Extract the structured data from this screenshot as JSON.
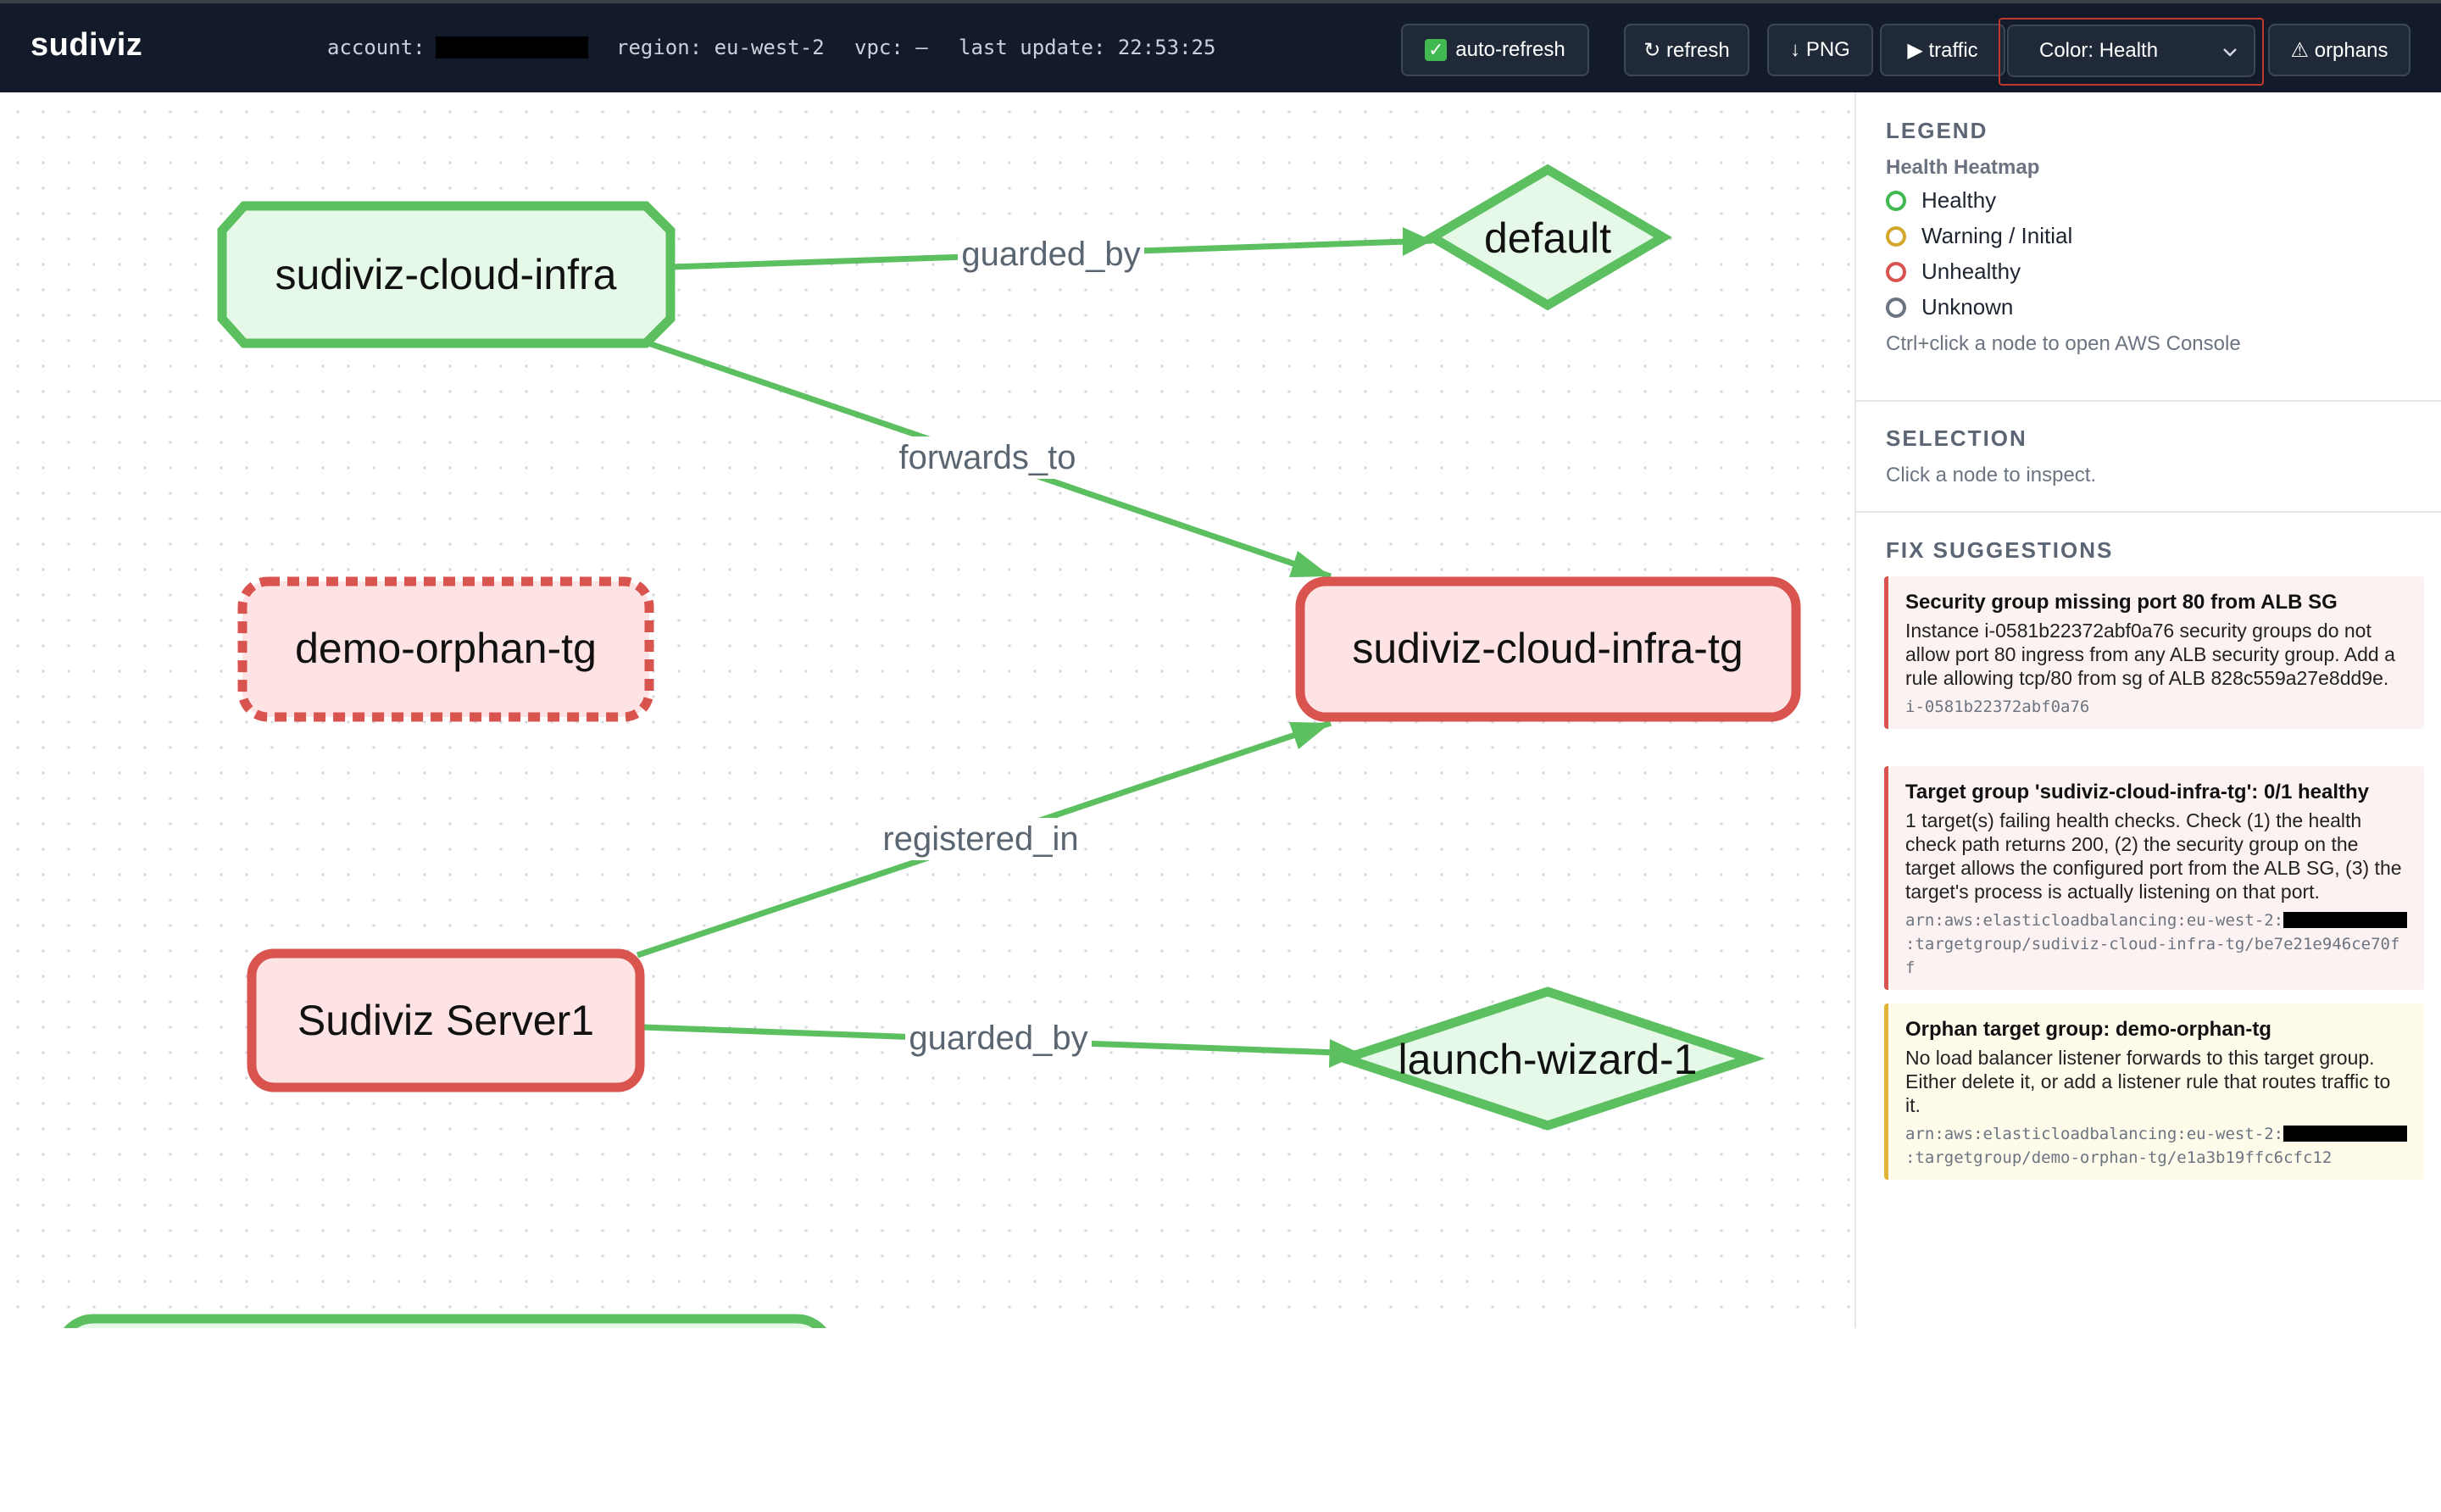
{
  "app": {
    "brand": "sudiviz"
  },
  "meta": {
    "account_label": "account:",
    "region_text": "region: eu-west-2",
    "vpc_text": "vpc: —",
    "update_text": "last update: 22:53:25"
  },
  "toolbar": {
    "auto_refresh_label": "auto-refresh",
    "auto_refresh_checked": true,
    "refresh_label": "↻ refresh",
    "png_label": "↓ PNG",
    "traffic_label": "▶ traffic",
    "color_select_value": "Color: Health",
    "orphans_label": "⚠ orphans"
  },
  "graph": {
    "nodes": [
      {
        "id": "alb",
        "label": "sudiviz-cloud-infra",
        "shape": "octagon",
        "health": "healthy"
      },
      {
        "id": "sg_default",
        "label": "default",
        "shape": "diamond",
        "health": "healthy"
      },
      {
        "id": "orphan_tg",
        "label": "demo-orphan-tg",
        "shape": "rounded-dashed",
        "health": "unhealthy"
      },
      {
        "id": "tg",
        "label": "sudiviz-cloud-infra-tg",
        "shape": "rounded",
        "health": "unhealthy"
      },
      {
        "id": "server",
        "label": "Sudiviz Server1",
        "shape": "rounded",
        "health": "unhealthy"
      },
      {
        "id": "sg_wizard",
        "label": "launch-wizard-1",
        "shape": "diamond",
        "health": "healthy"
      }
    ],
    "edges": [
      {
        "from": "alb",
        "to": "sg_default",
        "label": "guarded_by"
      },
      {
        "from": "alb",
        "to": "tg",
        "label": "forwards_to"
      },
      {
        "from": "server",
        "to": "tg",
        "label": "registered_in"
      },
      {
        "from": "server",
        "to": "sg_wizard",
        "label": "guarded_by"
      }
    ],
    "colors": {
      "healthy_stroke": "#5cbf60",
      "healthy_fill": "#e6f8e7",
      "unhealthy_stroke": "#d9534f",
      "unhealthy_fill": "#fde3e3",
      "edge": "#5cbf60"
    }
  },
  "legend": {
    "title": "LEGEND",
    "subtitle": "Health Heatmap",
    "items": [
      {
        "label": "Healthy",
        "color": "#3fb950"
      },
      {
        "label": "Warning / Initial",
        "color": "#d4a72c"
      },
      {
        "label": "Unhealthy",
        "color": "#d9534f"
      },
      {
        "label": "Unknown",
        "color": "#6b7480"
      }
    ],
    "hint": "Ctrl+click a node to open AWS Console"
  },
  "selection": {
    "title": "SELECTION",
    "hint": "Click a node to inspect."
  },
  "fix_suggestions": {
    "title": "FIX SUGGESTIONS",
    "items": [
      {
        "title": "Security group missing port 80 from ALB SG",
        "body": "Instance i-0581b22372abf0a76 security groups do not allow port 80 ingress from any ALB security group. Add a rule allowing tcp/80 from sg of ALB 828c559a27e8dd9e.",
        "ref": "i-0581b22372abf0a76"
      },
      {
        "title": "Target group 'sudiviz-cloud-infra-tg': 0/1 healthy",
        "body": "1 target(s) failing health checks. Check (1) the health check path returns 200, (2) the security group on the target allows the configured port from the ALB SG, (3) the target's process is actually listening on that port.",
        "ref_prefix": "arn:aws:elasticloadbalancing:eu-west-2:",
        "ref_suffix": ":targetgroup/sudiviz-cloud-infra-tg/be7e21e946ce70ff"
      },
      {
        "title": "Orphan target group: demo-orphan-tg",
        "body": "No load balancer listener forwards to this target group. Either delete it, or add a listener rule that routes traffic to it.",
        "ref_prefix": "arn:aws:elasticloadbalancing:eu-west-2:",
        "ref_suffix": ":targetgroup/demo-orphan-tg/e1a3b19ffc6cfc12"
      }
    ]
  }
}
